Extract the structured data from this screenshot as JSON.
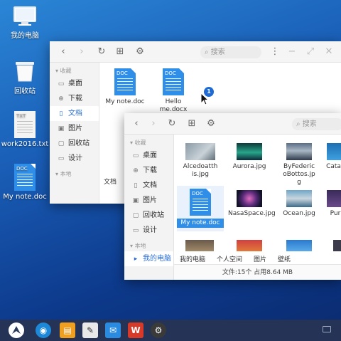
{
  "desktop": {
    "icons": [
      {
        "label": "我的电脑",
        "icon": "monitor-icon"
      },
      {
        "label": "回收站",
        "icon": "trash-icon"
      },
      {
        "label": "work2016.txt",
        "type_tag": "TXT",
        "icon": "txt-file-icon"
      },
      {
        "label": "My note.doc",
        "type_tag": "DOC",
        "icon": "doc-file-icon"
      }
    ],
    "drag_badge": "1"
  },
  "window_back": {
    "search_placeholder": "搜索",
    "sidebar_section": "收藏",
    "sidebar_items": [
      {
        "label": "桌面",
        "icon": "desktop-icon"
      },
      {
        "label": "下载",
        "icon": "download-icon"
      },
      {
        "label": "文档",
        "icon": "document-icon",
        "active": true
      },
      {
        "label": "图片",
        "icon": "image-icon"
      },
      {
        "label": "回收站",
        "icon": "trash-icon"
      },
      {
        "label": "设计",
        "icon": "monitor-icon"
      }
    ],
    "sidebar_section2": "本地",
    "files": [
      {
        "label": "My note.doc",
        "type_tag": "DOC"
      },
      {
        "label": "Hello me.docx",
        "type_tag": "DOC"
      }
    ],
    "tab_label": "文档"
  },
  "window_front": {
    "search_placeholder": "搜索",
    "sidebar_section": "收藏",
    "sidebar_items": [
      {
        "label": "桌面",
        "icon": "desktop-icon"
      },
      {
        "label": "下载",
        "icon": "download-icon"
      },
      {
        "label": "文档",
        "icon": "document-icon"
      },
      {
        "label": "图片",
        "icon": "image-icon"
      },
      {
        "label": "回收站",
        "icon": "trash-icon"
      },
      {
        "label": "设计",
        "icon": "monitor-icon"
      }
    ],
    "sidebar_section2": "本地",
    "sidebar_local": "我的电脑",
    "files": [
      {
        "label": "Alcedoatthis.jpg"
      },
      {
        "label": "Aurora.jpg"
      },
      {
        "label": "ByFedericoBottos.jpg"
      },
      {
        "label": "Catali"
      },
      {
        "label": "My note.doc",
        "type_tag": "DOC",
        "selected": true
      },
      {
        "label": "NasaSpace.jpg"
      },
      {
        "label": "Ocean.jpg"
      },
      {
        "label": "Pur"
      }
    ],
    "tabs": [
      "我的电脑",
      "个人空间",
      "图片",
      "壁纸"
    ],
    "status": "文件:15个 占用8.64 MB"
  },
  "taskbar": {
    "apps": [
      "launcher-icon",
      "browser-icon",
      "files-icon",
      "notes-icon",
      "mail-icon",
      "wps-icon",
      "settings-icon"
    ],
    "wps_letter": "W",
    "tray": "keyboard-icon"
  },
  "colors": {
    "accent": "#2f8ee8",
    "selection": "#2f8ee8",
    "taskbar": "#243356"
  }
}
